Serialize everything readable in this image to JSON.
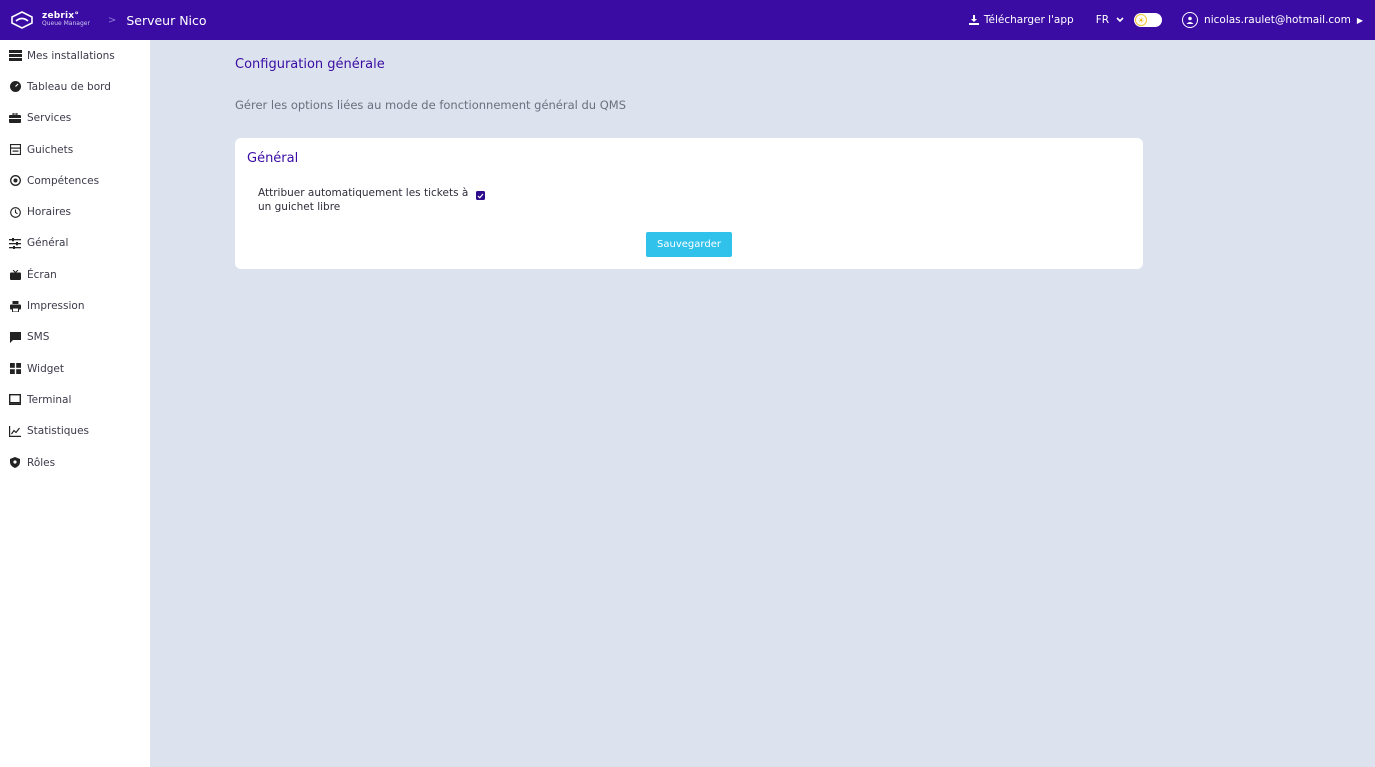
{
  "topbar": {
    "brand_name": "zebrix°",
    "brand_sub": "Queue Manager",
    "separator": ">",
    "server_name": "Serveur Nico",
    "download_label": "Télécharger l'app",
    "language": "FR",
    "user_email": "nicolas.raulet@hotmail.com"
  },
  "sidebar": {
    "items": [
      {
        "label": "Mes installations",
        "icon": "list-icon"
      },
      {
        "label": "Tableau de bord",
        "icon": "dashboard-icon"
      },
      {
        "label": "Services",
        "icon": "briefcase-icon"
      },
      {
        "label": "Guichets",
        "icon": "counter-icon"
      },
      {
        "label": "Compétences",
        "icon": "target-icon"
      },
      {
        "label": "Horaires",
        "icon": "clock-icon"
      },
      {
        "label": "Général",
        "icon": "sliders-icon"
      },
      {
        "label": "Écran",
        "icon": "tv-icon"
      },
      {
        "label": "Impression",
        "icon": "printer-icon"
      },
      {
        "label": "SMS",
        "icon": "message-icon"
      },
      {
        "label": "Widget",
        "icon": "widget-icon"
      },
      {
        "label": "Terminal",
        "icon": "terminal-icon"
      },
      {
        "label": "Statistiques",
        "icon": "chart-icon"
      },
      {
        "label": "Rôles",
        "icon": "shield-icon"
      }
    ]
  },
  "main": {
    "title": "Configuration générale",
    "description": "Gérer les options liées au mode de fonctionnement général du QMS",
    "card": {
      "title": "Général",
      "option_label": "Attribuer automatiquement les tickets à un guichet libre",
      "option_checked": true,
      "save_label": "Sauvegarder"
    }
  },
  "colors": {
    "topbar": "#3a0ca3",
    "accent": "#3a0ca3",
    "button": "#31c2ec",
    "background": "#dde3ee"
  }
}
